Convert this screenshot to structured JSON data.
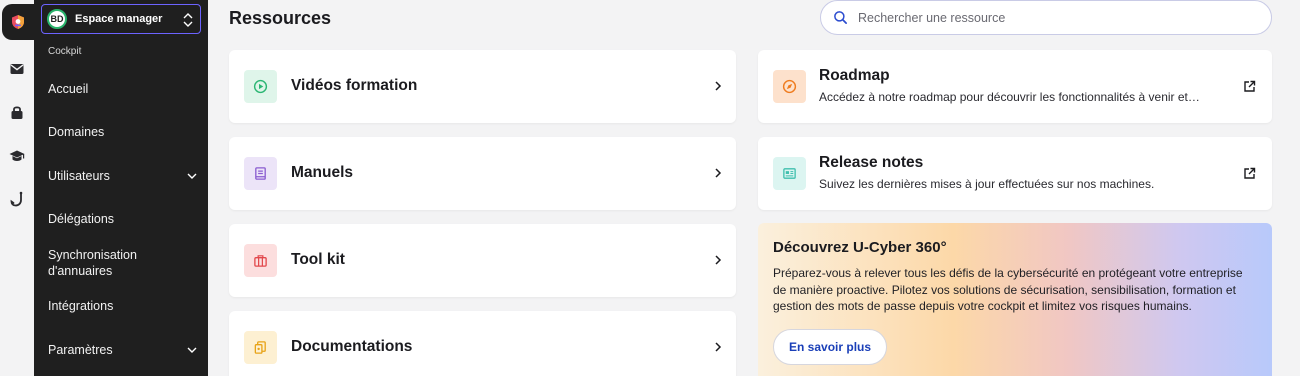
{
  "rail": {
    "items": [
      {
        "icon": "shield-logo-icon"
      },
      {
        "icon": "mail-icon"
      },
      {
        "icon": "lock-icon"
      },
      {
        "icon": "graduation-cap-icon"
      },
      {
        "icon": "hook-icon"
      }
    ]
  },
  "sidebar": {
    "switcher": {
      "initials": "BD",
      "label": "Espace manager"
    },
    "section_label": "Cockpit",
    "items": [
      {
        "label": "Accueil"
      },
      {
        "label": "Domaines"
      },
      {
        "label": "Utilisateurs",
        "expandable": true
      },
      {
        "label": "Délégations"
      },
      {
        "label": "Synchronisation d'annuaires"
      },
      {
        "label": "Intégrations"
      },
      {
        "label": "Paramètres",
        "expandable": true
      }
    ]
  },
  "main": {
    "title": "Ressources",
    "search": {
      "placeholder": "Rechercher une ressource"
    },
    "left_cards": [
      {
        "title": "Vidéos formation",
        "icon": "play-circle-icon",
        "icon_bg": "#dff5ea",
        "icon_color": "#2bb673"
      },
      {
        "title": "Manuels",
        "icon": "book-icon",
        "icon_bg": "#ece4f8",
        "icon_color": "#8a5cd0"
      },
      {
        "title": "Tool kit",
        "icon": "toolbox-icon",
        "icon_bg": "#fcdede",
        "icon_color": "#e2474b"
      },
      {
        "title": "Documentations",
        "icon": "documents-icon",
        "icon_bg": "#fdf0d2",
        "icon_color": "#e8a317"
      }
    ],
    "right_cards": [
      {
        "title": "Roadmap",
        "subtitle": "Accédez à notre roadmap pour découvrir les fonctionnalités à venir et…",
        "icon": "compass-icon",
        "icon_bg": "#fde1cc",
        "icon_color": "#ef7b1e"
      },
      {
        "title": "Release notes",
        "subtitle": "Suivez les dernières mises à jour effectuées sur nos machines.",
        "icon": "newspaper-icon",
        "icon_bg": "#dcf5f1",
        "icon_color": "#3fbfae"
      }
    ],
    "promo": {
      "title": "Découvrez U-Cyber 360°",
      "body": "Préparez-vous à relever tous les défis de la cybersécurité en protégeant votre entreprise de manière proactive. Pilotez vos solutions de sécurisation, sensibilisation, formation et gestion des mots de passe depuis votre cockpit et limitez vos risques humains.",
      "button_label": "En savoir plus"
    }
  }
}
